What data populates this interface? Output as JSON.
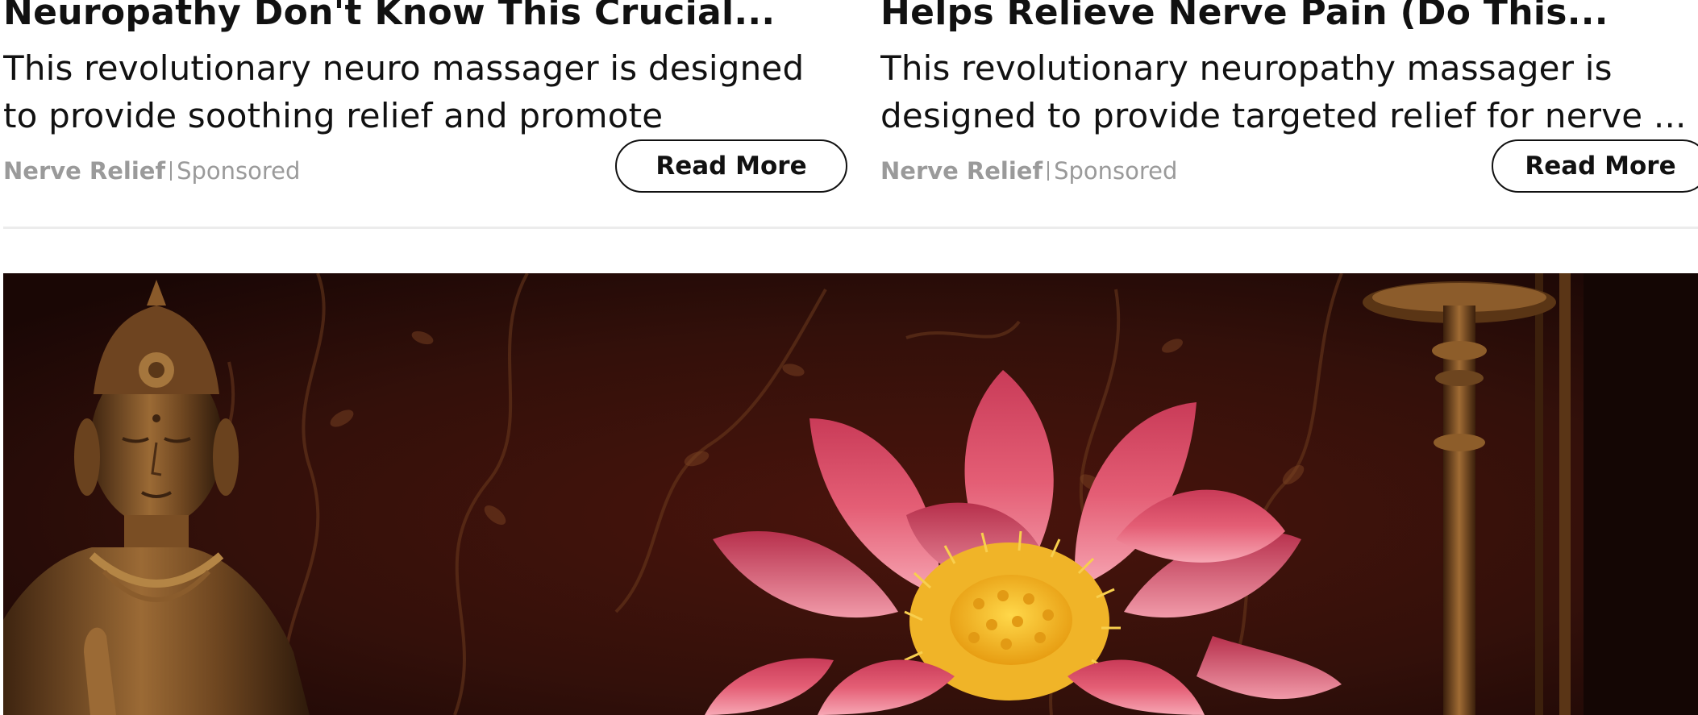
{
  "ads": [
    {
      "headline": "Neuropathy Don't Know This Crucial...",
      "description": "This revolutionary neuro massager is designed to provide soothing relief and promote relaxation. ...",
      "source": "Nerve Relief",
      "label": "Sponsored",
      "cta": "Read More"
    },
    {
      "headline": "Helps Relieve Nerve Pain (Do This...",
      "description": "This revolutionary neuropathy massager is designed to provide targeted relief for nerve ...",
      "source": "Nerve Relief",
      "label": "Sponsored",
      "cta": "Read More"
    }
  ],
  "hero": {
    "subject": "lotus-flower-with-buddha-statue-image"
  },
  "colors": {
    "text": "#111111",
    "muted": "#9a9a9a",
    "divider": "#ececec",
    "hero_background": "#2a0c07",
    "lotus_petal": "#e0566e",
    "lotus_center": "#f4b81e",
    "statue_bronze": "#8a5a2a"
  }
}
